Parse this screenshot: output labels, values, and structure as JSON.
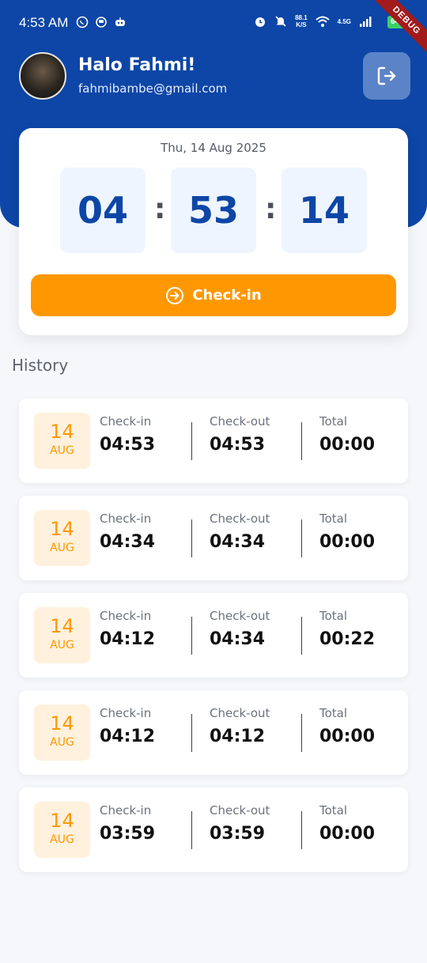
{
  "status": {
    "time": "4:53 AM",
    "net_speed_top": "88.1",
    "net_speed_bottom": "K/S",
    "net_type": "4.5G",
    "battery": "64",
    "debug": "DEBUG"
  },
  "profile": {
    "greeting": "Halo Fahmi!",
    "email": "fahmibambe@gmail.com"
  },
  "clock": {
    "date": "Thu, 14 Aug 2025",
    "hours": "04",
    "minutes": "53",
    "seconds": "14",
    "separator": ":",
    "checkin_label": "Check-in"
  },
  "history": {
    "title": "History",
    "labels": {
      "checkin": "Check-in",
      "checkout": "Check-out",
      "total": "Total"
    },
    "items": [
      {
        "day": "14",
        "month": "AUG",
        "checkin": "04:53",
        "checkout": "04:53",
        "total": "00:00"
      },
      {
        "day": "14",
        "month": "AUG",
        "checkin": "04:34",
        "checkout": "04:34",
        "total": "00:00"
      },
      {
        "day": "14",
        "month": "AUG",
        "checkin": "04:12",
        "checkout": "04:34",
        "total": "00:22"
      },
      {
        "day": "14",
        "month": "AUG",
        "checkin": "04:12",
        "checkout": "04:12",
        "total": "00:00"
      },
      {
        "day": "14",
        "month": "AUG",
        "checkin": "03:59",
        "checkout": "03:59",
        "total": "00:00"
      }
    ]
  },
  "colors": {
    "primary": "#0d46a6",
    "accent": "#ff9800",
    "badge_bg": "#fff1dd",
    "time_box_bg": "#eef5ff"
  }
}
